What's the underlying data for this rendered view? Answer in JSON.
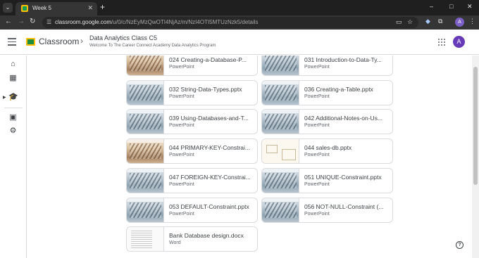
{
  "browser": {
    "tab_title": "Week 5",
    "tab_close": "✕",
    "tab_list": "⌄",
    "new_tab": "+",
    "window_controls": {
      "minimize": "–",
      "maximize": "□",
      "close": "✕"
    },
    "url_host": "classroom.google.com",
    "url_path": "/u/0/c/NzEyMzQwOTI4NjAz/m/NzI4OTI5MTUzNzk5/details",
    "profile_initial": "A",
    "icons": [
      "back-icon",
      "forward-icon",
      "reload-icon",
      "site-info-icon",
      "install-app-icon",
      "bookmark-star-icon",
      "extension-icon",
      "puzzle-icon",
      "kebab-menu-icon"
    ]
  },
  "header": {
    "app_name": "Classroom",
    "class_name": "Data Analytics Class C5",
    "class_subtitle": "Welcome To The Career Connect Academy Data Analytics Program",
    "avatar_initial": "A",
    "colors": {
      "logo_yellow": "#fbbc04",
      "logo_green": "#1e8e3e",
      "avatar": "#673ab7"
    }
  },
  "rail": {
    "icons": [
      "home-icon",
      "calendar-icon",
      "enrolled-classes-icon",
      "archive-icon",
      "settings-icon"
    ]
  },
  "attachments": [
    {
      "title": "024 Creating-a-Database-P...",
      "type": "PowerPoint",
      "thumb": "warm"
    },
    {
      "title": "031 Introduction-to-Data-Ty...",
      "type": "PowerPoint",
      "thumb": "ppt"
    },
    {
      "title": "032 String-Data-Types.pptx",
      "type": "PowerPoint",
      "thumb": "ppt"
    },
    {
      "title": "036 Creating-a-Table.pptx",
      "type": "PowerPoint",
      "thumb": "ppt"
    },
    {
      "title": "039 Using-Databases-and-T...",
      "type": "PowerPoint",
      "thumb": "ppt"
    },
    {
      "title": "042 Additional-Notes-on-Us...",
      "type": "PowerPoint",
      "thumb": "ppt"
    },
    {
      "title": "044 PRIMARY-KEY-Constrai...",
      "type": "PowerPoint",
      "thumb": "warm"
    },
    {
      "title": "044 sales-db.pptx",
      "type": "PowerPoint",
      "thumb": "diagram"
    },
    {
      "title": "047 FOREIGN-KEY-Constrai...",
      "type": "PowerPoint",
      "thumb": "ppt"
    },
    {
      "title": "051 UNIQUE-Constraint.pptx",
      "type": "PowerPoint",
      "thumb": "ppt"
    },
    {
      "title": "053 DEFAULT-Constraint.pptx",
      "type": "PowerPoint",
      "thumb": "ppt"
    },
    {
      "title": "056 NOT-NULL-Constraint (...",
      "type": "PowerPoint",
      "thumb": "ppt"
    },
    {
      "title": "Bank Database design.docx",
      "type": "Word",
      "thumb": "doc"
    }
  ],
  "help_label": "?"
}
